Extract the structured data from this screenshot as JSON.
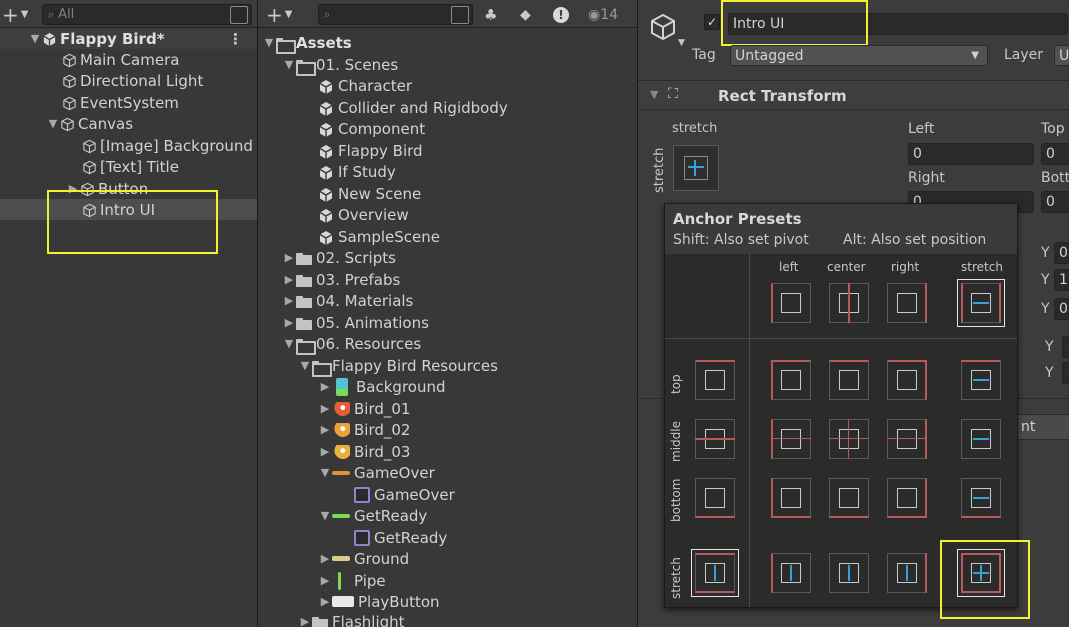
{
  "hierarchy": {
    "search_placeholder": "All",
    "items": [
      {
        "label": "Flappy Bird*"
      },
      {
        "label": "Main Camera"
      },
      {
        "label": "Directional Light"
      },
      {
        "label": "EventSystem"
      },
      {
        "label": "Canvas"
      },
      {
        "label": "[Image] Background"
      },
      {
        "label": "[Text] Title"
      },
      {
        "label": "Button"
      },
      {
        "label": "Intro UI"
      }
    ]
  },
  "project": {
    "hidden_count": "14",
    "items": [
      {
        "label": "Assets"
      },
      {
        "label": "01. Scenes"
      },
      {
        "label": "Character"
      },
      {
        "label": "Collider and Rigidbody"
      },
      {
        "label": "Component"
      },
      {
        "label": "Flappy Bird"
      },
      {
        "label": "If Study"
      },
      {
        "label": "New Scene"
      },
      {
        "label": "Overview"
      },
      {
        "label": "SampleScene"
      },
      {
        "label": "02. Scripts"
      },
      {
        "label": "03. Prefabs"
      },
      {
        "label": "04. Materials"
      },
      {
        "label": "05. Animations"
      },
      {
        "label": "06. Resources"
      },
      {
        "label": "Flappy Bird Resources"
      },
      {
        "label": "Background"
      },
      {
        "label": "Bird_01"
      },
      {
        "label": "Bird_02"
      },
      {
        "label": "Bird_03"
      },
      {
        "label": "GameOver"
      },
      {
        "label": "GameOver"
      },
      {
        "label": "GetReady"
      },
      {
        "label": "GetReady"
      },
      {
        "label": "Ground"
      },
      {
        "label": "Pipe"
      },
      {
        "label": "PlayButton"
      },
      {
        "label": "Flashlight"
      }
    ]
  },
  "inspector": {
    "object_name": "Intro UI",
    "tag_label": "Tag",
    "tag_value": "Untagged",
    "layer_label": "Layer",
    "layer_value": "U",
    "component_title": "Rect Transform",
    "anchor_label_top": "stretch",
    "anchor_label_side": "stretch",
    "left_label": "Left",
    "left_value": "0",
    "top_label": "Top",
    "top_value": "0",
    "right_label": "Right",
    "right_value": "0",
    "bottom_label": "Bott",
    "bottom_value": "0",
    "y_labels": [
      "Y",
      "Y",
      "Y",
      "Y",
      "Y"
    ],
    "y_values": [
      "0",
      "1",
      "0"
    ],
    "partial_button": "nt"
  },
  "anchor_presets": {
    "title": "Anchor Presets",
    "hint_shift": "Shift: Also set pivot",
    "hint_alt": "Alt: Also set position",
    "columns": [
      "left",
      "center",
      "right",
      "stretch"
    ],
    "rows": [
      "top",
      "middle",
      "bottom",
      "stretch"
    ],
    "selected": "stretch-stretch"
  },
  "colors": {
    "highlight": "#f2f231",
    "anchor_orange": "#e8902a",
    "anchor_blue": "#3aa0d8"
  }
}
